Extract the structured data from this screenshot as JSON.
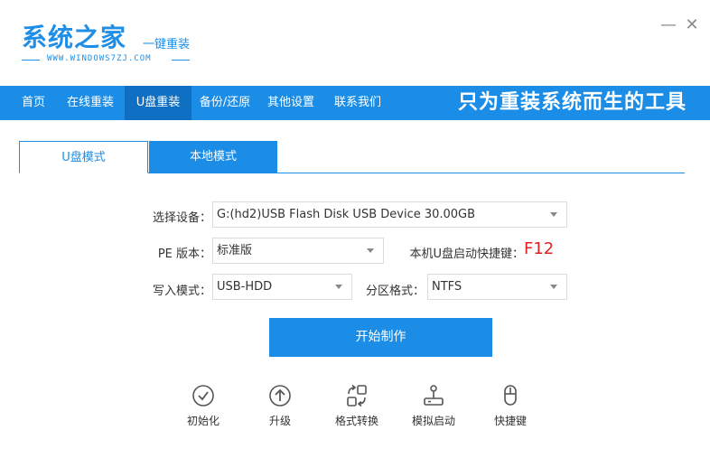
{
  "header": {
    "logo_title": "系统之家",
    "logo_tagline": "一键重装",
    "logo_url": "WWW.WINDOWS7ZJ.COM"
  },
  "window_controls": {
    "minimize": "—",
    "close": "✕"
  },
  "nav": {
    "items": [
      {
        "label": "首页"
      },
      {
        "label": "在线重装"
      },
      {
        "label": "U盘重装"
      },
      {
        "label": "备份/还原"
      },
      {
        "label": "其他设置"
      },
      {
        "label": "联系我们"
      }
    ],
    "active": "U盘重装",
    "slogan": "只为重装系统而生的工具"
  },
  "tabs": {
    "u_mode": "U盘模式",
    "local_mode": "本地模式",
    "active": "U盘模式"
  },
  "form": {
    "device_label": "选择设备：",
    "device_value": "G:(hd2)USB Flash Disk USB Device 30.00GB",
    "pe_label": "PE 版本：",
    "pe_value": "标准版",
    "hotkey_label": "本机U盘启动快捷键：",
    "hotkey_value": "F12",
    "write_label": "写入模式：",
    "write_value": "USB-HDD",
    "partition_label": "分区格式：",
    "partition_value": "NTFS"
  },
  "start_button": "开始制作",
  "tools": [
    {
      "label": "初始化",
      "icon": "check-circle-icon"
    },
    {
      "label": "升级",
      "icon": "arrow-up-circle-icon"
    },
    {
      "label": "格式转换",
      "icon": "convert-icon"
    },
    {
      "label": "模拟启动",
      "icon": "joystick-icon"
    },
    {
      "label": "快捷键",
      "icon": "mouse-icon"
    }
  ],
  "colors": {
    "brand": "#1b8de6",
    "nav_active": "#0f6fc2",
    "hotkey": "#e02020"
  }
}
